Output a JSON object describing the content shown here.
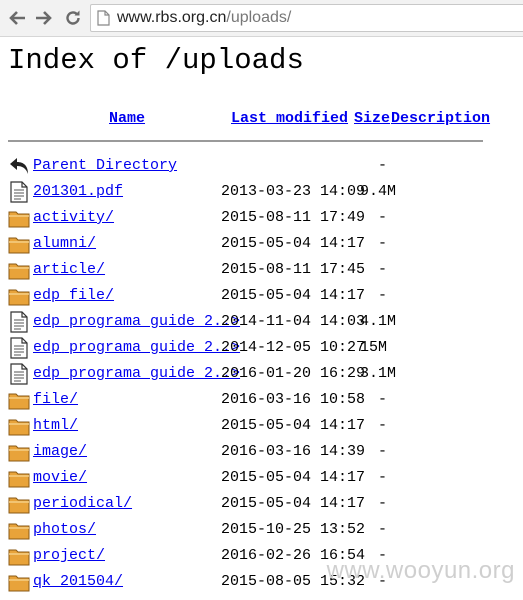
{
  "browser": {
    "url_host": "www.rbs.org.cn",
    "url_path": "/uploads/"
  },
  "page": {
    "title": "Index of /uploads",
    "columns": {
      "name": "Name",
      "last_modified": "Last modified",
      "size": "Size",
      "description": "Description"
    }
  },
  "rows": [
    {
      "name": "Parent Directory",
      "date": "",
      "size": "-",
      "icon": "back-icon"
    },
    {
      "name": "201301.pdf",
      "date": "2013-03-23 14:09",
      "size": "9.4M",
      "icon": "file-icon"
    },
    {
      "name": "activity/",
      "date": "2015-08-11 17:49",
      "size": "-",
      "icon": "folder-icon"
    },
    {
      "name": "alumni/",
      "date": "2015-05-04 14:17",
      "size": "-",
      "icon": "folder-icon"
    },
    {
      "name": "article/",
      "date": "2015-08-11 17:45",
      "size": "-",
      "icon": "folder-icon"
    },
    {
      "name": "edp file/",
      "date": "2015-05-04 14:17",
      "size": "-",
      "icon": "folder-icon"
    },
    {
      "name": "edp programa guide 2..>",
      "date": "2014-11-04 14:03",
      "size": "4.1M",
      "icon": "file-icon"
    },
    {
      "name": "edp programa guide 2..>",
      "date": "2014-12-05 10:27",
      "size": "15M",
      "icon": "file-icon"
    },
    {
      "name": "edp programa guide 2..>",
      "date": "2016-01-20 16:29",
      "size": "3.1M",
      "icon": "file-icon"
    },
    {
      "name": "file/",
      "date": "2016-03-16 10:58",
      "size": "-",
      "icon": "folder-icon"
    },
    {
      "name": "html/",
      "date": "2015-05-04 14:17",
      "size": "-",
      "icon": "folder-icon"
    },
    {
      "name": "image/",
      "date": "2016-03-16 14:39",
      "size": "-",
      "icon": "folder-icon"
    },
    {
      "name": "movie/",
      "date": "2015-05-04 14:17",
      "size": "-",
      "icon": "folder-icon"
    },
    {
      "name": "periodical/",
      "date": "2015-05-04 14:17",
      "size": "-",
      "icon": "folder-icon"
    },
    {
      "name": "photos/",
      "date": "2015-10-25 13:52",
      "size": "-",
      "icon": "folder-icon"
    },
    {
      "name": "project/",
      "date": "2016-02-26 16:54",
      "size": "-",
      "icon": "folder-icon"
    },
    {
      "name": "qk 201504/",
      "date": "2015-08-05 15:32",
      "size": "-",
      "icon": "folder-icon"
    }
  ],
  "watermark": "www.wooyun.org",
  "colors": {
    "link": "#0000ee",
    "folder": "#e8a33a",
    "rule": "#9a9a9a"
  }
}
